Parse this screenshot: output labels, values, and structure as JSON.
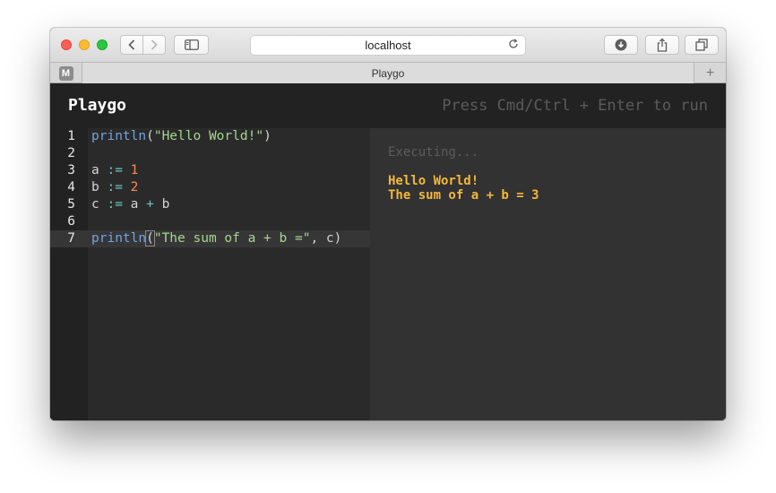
{
  "browser": {
    "address": "localhost",
    "tab_title": "Playgo",
    "pinned_tab_letter": "M",
    "new_tab_symbol": "+"
  },
  "app": {
    "brand": "Playgo",
    "run_hint": "Press Cmd/Ctrl + Enter to run"
  },
  "editor": {
    "active_line": 7,
    "lines": [
      {
        "num": "1"
      },
      {
        "num": "2"
      },
      {
        "num": "3"
      },
      {
        "num": "4"
      },
      {
        "num": "5"
      },
      {
        "num": "6"
      },
      {
        "num": "7"
      }
    ],
    "tokens": {
      "l1_fn": "println",
      "l1_open": "(",
      "l1_str": "\"Hello World!\"",
      "l1_close": ")",
      "l3_id": "a",
      "l3_op": ":=",
      "l3_num": "1",
      "l4_id": "b",
      "l4_op": ":=",
      "l4_num": "2",
      "l5_id": "c",
      "l5_op": ":=",
      "l5_a": "a",
      "l5_plus": "+",
      "l5_b": "b",
      "l7_fn": "println",
      "l7_open": "(",
      "l7_str": "\"The sum of a + b =\"",
      "l7_rest": ", c)"
    }
  },
  "output": {
    "status": "Executing...",
    "lines": [
      "Hello World!",
      "The sum of a + b = 3"
    ]
  },
  "colors": {
    "header_bg": "#222222",
    "editor_bg": "#2a2a2a",
    "output_bg": "#323232",
    "output_text": "#f5b73a",
    "func": "#71a4e2",
    "string": "#a7d690",
    "number": "#ff8852"
  },
  "icons": {
    "back": "chevron-left-icon",
    "forward": "chevron-right-icon",
    "sidebar": "sidebar-icon",
    "reload": "reload-icon",
    "download": "download-icon",
    "share": "share-icon",
    "tabs": "tabs-overview-icon"
  }
}
